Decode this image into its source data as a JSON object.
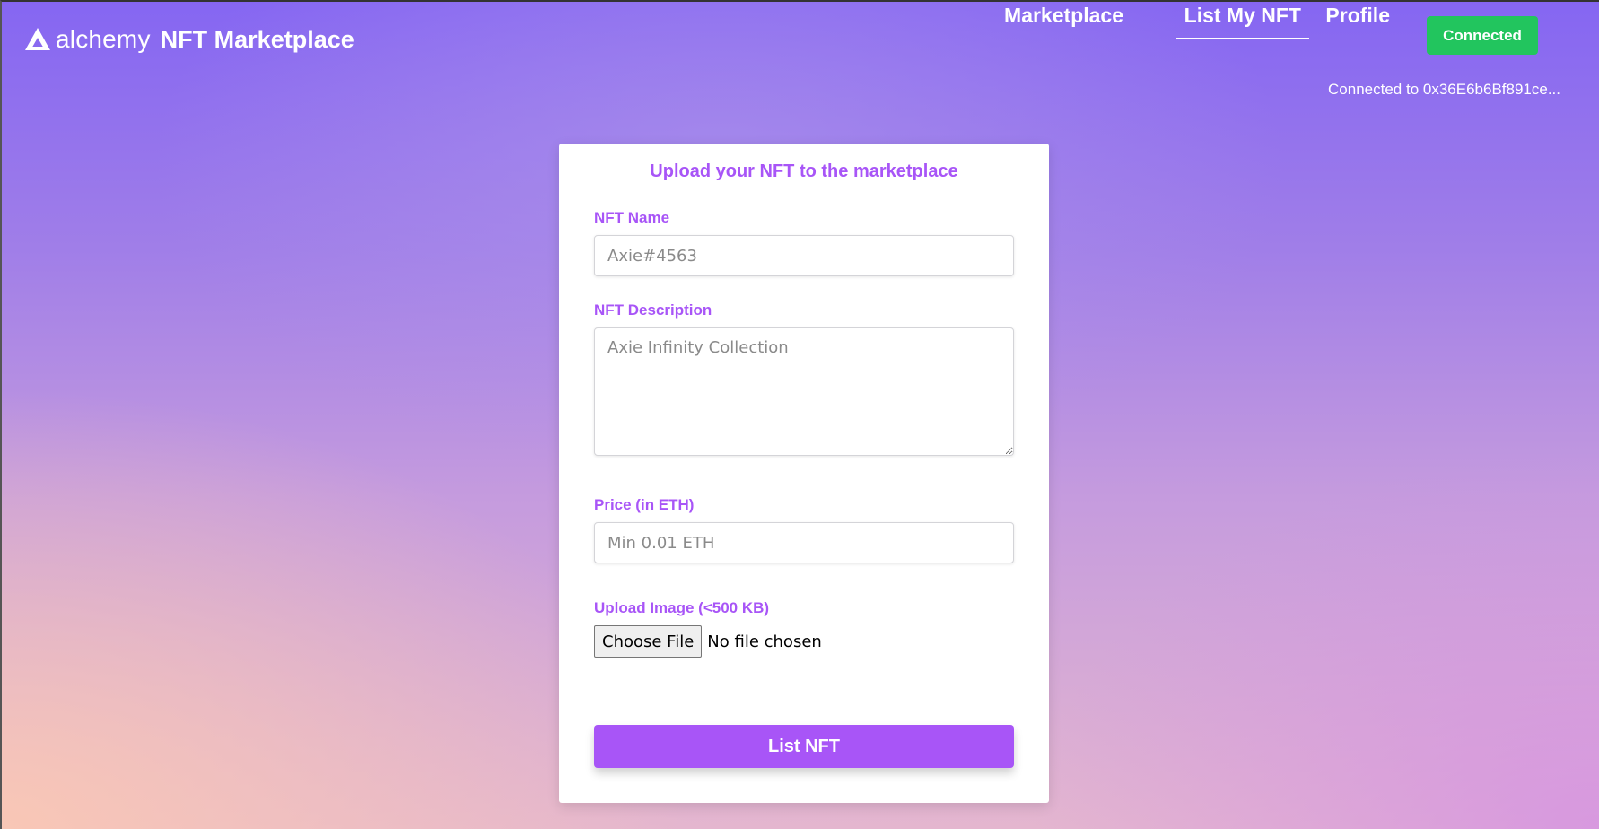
{
  "brand": {
    "logo_icon": "alchemy-logo-icon",
    "logo_word": "alchemy",
    "title": "NFT Marketplace"
  },
  "nav": {
    "marketplace": "Marketplace",
    "list_my_nft": "List My NFT",
    "profile": "Profile",
    "active": "List My NFT"
  },
  "wallet": {
    "button_label": "Connected",
    "status_text": "Connected to 0x36E6b6Bf891ce...",
    "button_color": "#22c55e"
  },
  "form": {
    "title": "Upload your NFT to the marketplace",
    "name_label": "NFT Name",
    "name_placeholder": "Axie#4563",
    "name_value": "",
    "description_label": "NFT Description",
    "description_placeholder": "Axie Infinity Collection",
    "description_value": "",
    "price_label": "Price (in ETH)",
    "price_placeholder": "Min 0.01 ETH",
    "price_value": "",
    "image_label": "Upload Image (<500 KB)",
    "file_button": "Choose File",
    "file_status": "No file chosen",
    "submit_label": "List NFT"
  },
  "colors": {
    "accent": "#a855f7",
    "success": "#22c55e"
  }
}
